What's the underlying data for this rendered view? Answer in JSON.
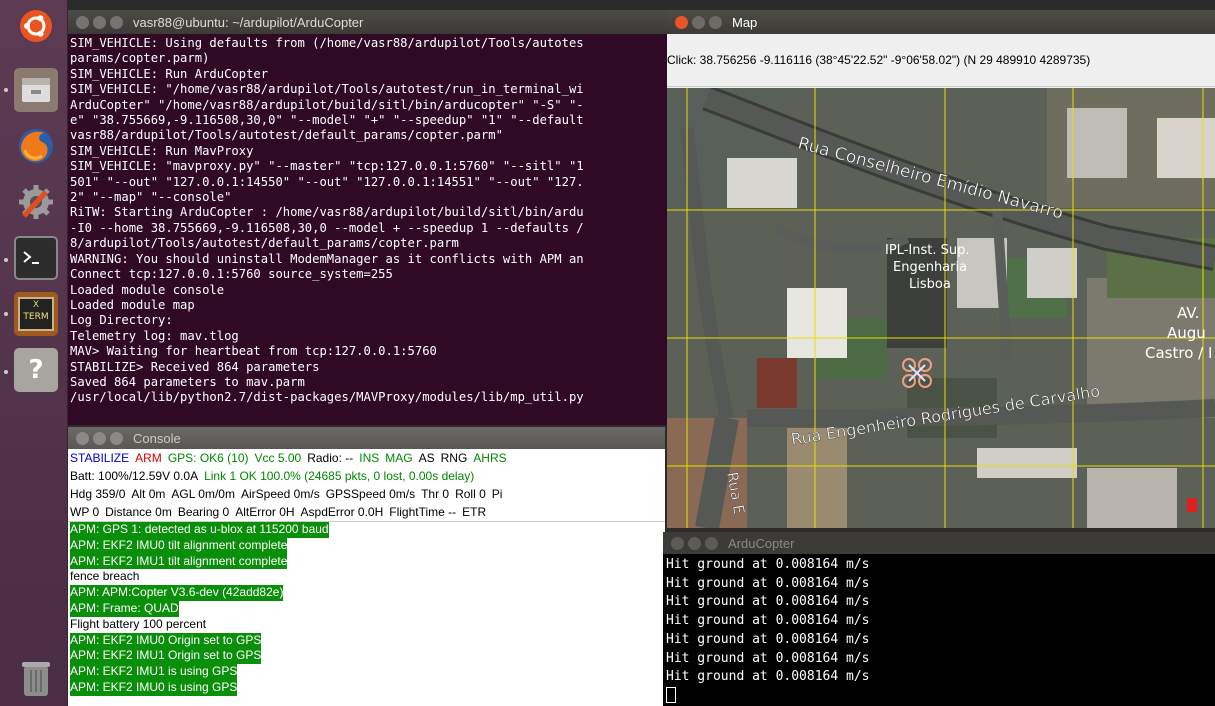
{
  "terminal": {
    "title": "vasr88@ubuntu: ~/ardupilot/ArduCopter",
    "lines": [
      "SIM_VEHICLE: Using defaults from (/home/vasr88/ardupilot/Tools/autotes",
      "params/copter.parm)",
      "SIM_VEHICLE: Run ArduCopter",
      "SIM_VEHICLE: \"/home/vasr88/ardupilot/Tools/autotest/run_in_terminal_wi",
      "ArduCopter\" \"/home/vasr88/ardupilot/build/sitl/bin/arducopter\" \"-S\" \"-",
      "e\" \"38.755669,-9.116508,30,0\" \"--model\" \"+\" \"--speedup\" \"1\" \"--default",
      "vasr88/ardupilot/Tools/autotest/default_params/copter.parm\"",
      "SIM_VEHICLE: Run MavProxy",
      "SIM_VEHICLE: \"mavproxy.py\" \"--master\" \"tcp:127.0.0.1:5760\" \"--sitl\" \"1",
      "501\" \"--out\" \"127.0.0.1:14550\" \"--out\" \"127.0.0.1:14551\" \"--out\" \"127.",
      "2\" \"--map\" \"--console\"",
      "RiTW: Starting ArduCopter : /home/vasr88/ardupilot/build/sitl/bin/ardu",
      "-I0 --home 38.755669,-9.116508,30,0 --model + --speedup 1 --defaults /",
      "8/ardupilot/Tools/autotest/default_params/copter.parm",
      "WARNING: You should uninstall ModemManager as it conflicts with APM an",
      "Connect tcp:127.0.0.1:5760 source_system=255",
      "Loaded module console",
      "Loaded module map",
      "Log Directory:",
      "Telemetry log: mav.tlog",
      "MAV> Waiting for heartbeat from tcp:127.0.0.1:5760",
      "STABILIZE> Received 864 parameters",
      "Saved 864 parameters to mav.parm",
      "/usr/local/lib/python2.7/dist-packages/MAVProxy/modules/lib/mp_util.py"
    ]
  },
  "console": {
    "title": "Console",
    "status_row1": [
      {
        "text": "STABILIZE",
        "color": "#0000cc"
      },
      {
        "text": "ARM",
        "color": "#cc0000"
      },
      {
        "text": "GPS: OK6 (10)",
        "color": "#008800"
      },
      {
        "text": "Vcc 5.00",
        "color": "#008800"
      },
      {
        "text": "Radio: --",
        "color": "#000000"
      },
      {
        "text": "INS",
        "color": "#008800"
      },
      {
        "text": "MAG",
        "color": "#008800"
      },
      {
        "text": "AS",
        "color": "#000000"
      },
      {
        "text": "RNG",
        "color": "#000000"
      },
      {
        "text": "AHRS",
        "color": "#008800"
      }
    ],
    "status_row2": [
      {
        "text": "Batt: 100%/12.59V 0.0A",
        "color": "#000000"
      },
      {
        "text": "Link 1 OK 100.0% (24685 pkts, 0 lost, 0.00s delay)",
        "color": "#008800"
      }
    ],
    "status_row3": [
      "Hdg 359/0",
      "Alt 0m",
      "AGL 0m/0m",
      "AirSpeed 0m/s",
      "GPSSpeed 0m/s",
      "Thr 0",
      "Roll 0",
      "Pi"
    ],
    "status_row4": [
      "WP 0",
      "Distance 0m",
      "Bearing 0",
      "AltError 0H",
      "AspdError 0.0H",
      "FlightTime --",
      "ETR"
    ],
    "messages": [
      {
        "text": "APM: GPS 1: detected as u-blox at 115200 baud",
        "style": "green"
      },
      {
        "text": "APM: EKF2 IMU0 tilt alignment complete",
        "style": "green"
      },
      {
        "text": "APM: EKF2 IMU1 tilt alignment complete",
        "style": "green"
      },
      {
        "text": "fence breach",
        "style": "plain"
      },
      {
        "text": "APM: APM:Copter V3.6-dev (42add82e)",
        "style": "green"
      },
      {
        "text": "APM: Frame: QUAD",
        "style": "green"
      },
      {
        "text": "Flight battery 100 percent",
        "style": "plain"
      },
      {
        "text": "APM: EKF2 IMU0 Origin set to GPS",
        "style": "green"
      },
      {
        "text": "APM: EKF2 IMU1 Origin set to GPS",
        "style": "green"
      },
      {
        "text": "APM: EKF2 IMU1 is using GPS",
        "style": "green"
      },
      {
        "text": "APM: EKF2 IMU0 is using GPS",
        "style": "green"
      }
    ]
  },
  "map": {
    "title": "Map",
    "click_info": "Click: 38.756256 -9.116116 (38°45'22.52\" -9°06'58.02\") (N 29 489910 4289735)",
    "labels": {
      "street1": "Rua Conselheiro Emídio Navarro",
      "street2": "Rua Engenheiro Rodrigues de Carvalho",
      "street3": "Rua E",
      "poi_line1": "IPL-Inst. Sup.",
      "poi_line2": "Engenharia",
      "poi_line3": "Lisboa",
      "av1": "AV.",
      "av2": "Augu",
      "av3": "Castro / I"
    }
  },
  "ardu": {
    "title": "ArduCopter",
    "lines": [
      "Hit ground at 0.008164 m/s",
      "Hit ground at 0.008164 m/s",
      "Hit ground at 0.008164 m/s",
      "Hit ground at 0.008164 m/s",
      "Hit ground at 0.008164 m/s",
      "Hit ground at 0.008164 m/s",
      "Hit ground at 0.008164 m/s"
    ]
  },
  "launcher": {
    "items": [
      "ubuntu-dash-icon",
      "files-icon",
      "firefox-icon",
      "settings-icon",
      "terminal-icon",
      "xterm-icon",
      "help-icon",
      "trash-icon"
    ],
    "xterm_label_top": "X",
    "xterm_label_bottom": "TERM"
  }
}
